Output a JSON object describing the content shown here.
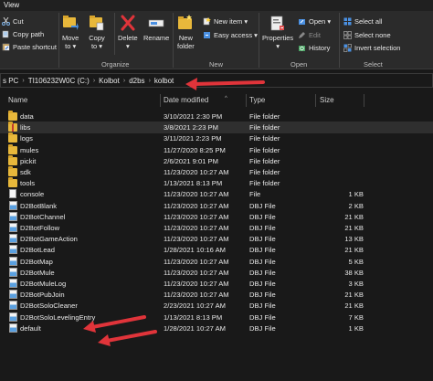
{
  "tab": "View",
  "ribbon": {
    "clipboard": {
      "cut": "Cut",
      "copy_path": "Copy path",
      "paste_shortcut": "Paste shortcut"
    },
    "organize": {
      "label": "Organize",
      "move_to": [
        "Move",
        "to ▾"
      ],
      "copy_to": [
        "Copy",
        "to ▾"
      ],
      "delete": [
        "Delete",
        "▾"
      ],
      "rename": "Rename"
    },
    "new": {
      "label": "New",
      "new_folder": [
        "New",
        "folder"
      ],
      "new_item": "New item ▾",
      "easy_access": "Easy access ▾"
    },
    "open": {
      "label": "Open",
      "properties": [
        "Properties",
        "▾"
      ],
      "open": "Open ▾",
      "edit": "Edit",
      "history": "History"
    },
    "select": {
      "label": "Select",
      "select_all": "Select all",
      "select_none": "Select none",
      "invert": "Invert selection"
    }
  },
  "address": {
    "crumbs": [
      "s PC",
      "TI106232W0C (C:)",
      "Kolbot",
      "d2bs",
      "kolbot"
    ]
  },
  "columns": {
    "name": "Name",
    "date": "Date modified",
    "type": "Type",
    "size": "Size"
  },
  "files": [
    {
      "name": "data",
      "date": "3/10/2021 2:30 PM",
      "type": "File folder",
      "size": "",
      "icon": "folder"
    },
    {
      "name": "libs",
      "date": "3/8/2021 2:23 PM",
      "type": "File folder",
      "size": "",
      "icon": "folder-zip",
      "selected": true
    },
    {
      "name": "logs",
      "date": "3/11/2021 2:23 PM",
      "type": "File folder",
      "size": "",
      "icon": "folder"
    },
    {
      "name": "mules",
      "date": "11/27/2020 8:25 PM",
      "type": "File folder",
      "size": "",
      "icon": "folder"
    },
    {
      "name": "pickit",
      "date": "2/6/2021 9:01 PM",
      "type": "File folder",
      "size": "",
      "icon": "folder"
    },
    {
      "name": "sdk",
      "date": "11/23/2020 10:27 AM",
      "type": "File folder",
      "size": "",
      "icon": "folder"
    },
    {
      "name": "tools",
      "date": "1/13/2021 8:13 PM",
      "type": "File folder",
      "size": "",
      "icon": "folder"
    },
    {
      "name": "console",
      "date": "11/23/2020 10:27 AM",
      "type": "File",
      "size": "1 KB",
      "icon": "file"
    },
    {
      "name": "D2BotBlank",
      "date": "11/23/2020 10:27 AM",
      "type": "DBJ File",
      "size": "2 KB",
      "icon": "dbj"
    },
    {
      "name": "D2BotChannel",
      "date": "11/23/2020 10:27 AM",
      "type": "DBJ File",
      "size": "21 KB",
      "icon": "dbj"
    },
    {
      "name": "D2BotFollow",
      "date": "11/23/2020 10:27 AM",
      "type": "DBJ File",
      "size": "21 KB",
      "icon": "dbj"
    },
    {
      "name": "D2BotGameAction",
      "date": "11/23/2020 10:27 AM",
      "type": "DBJ File",
      "size": "13 KB",
      "icon": "dbj"
    },
    {
      "name": "D2BotLead",
      "date": "1/28/2021 10:16 AM",
      "type": "DBJ File",
      "size": "21 KB",
      "icon": "dbj"
    },
    {
      "name": "D2BotMap",
      "date": "11/23/2020 10:27 AM",
      "type": "DBJ File",
      "size": "5 KB",
      "icon": "dbj"
    },
    {
      "name": "D2BotMule",
      "date": "11/23/2020 10:27 AM",
      "type": "DBJ File",
      "size": "38 KB",
      "icon": "dbj"
    },
    {
      "name": "D2BotMuleLog",
      "date": "11/23/2020 10:27 AM",
      "type": "DBJ File",
      "size": "3 KB",
      "icon": "dbj"
    },
    {
      "name": "D2BotPubJoin",
      "date": "11/23/2020 10:27 AM",
      "type": "DBJ File",
      "size": "21 KB",
      "icon": "dbj"
    },
    {
      "name": "D2BotSoloCleaner",
      "date": "2/23/2021 10:27 AM",
      "type": "DBJ File",
      "size": "21 KB",
      "icon": "dbj"
    },
    {
      "name": "D2BotSoloLevelingEntry",
      "date": "1/13/2021 8:13 PM",
      "type": "DBJ File",
      "size": "7 KB",
      "icon": "dbj"
    },
    {
      "name": "default",
      "date": "1/28/2021 10:27 AM",
      "type": "DBJ File",
      "size": "1 KB",
      "icon": "dbj"
    }
  ],
  "colors": {
    "arrow": "#e0343a",
    "folder": "#e8b83b",
    "background": "#191919",
    "ribbon": "#2b2b2b"
  }
}
